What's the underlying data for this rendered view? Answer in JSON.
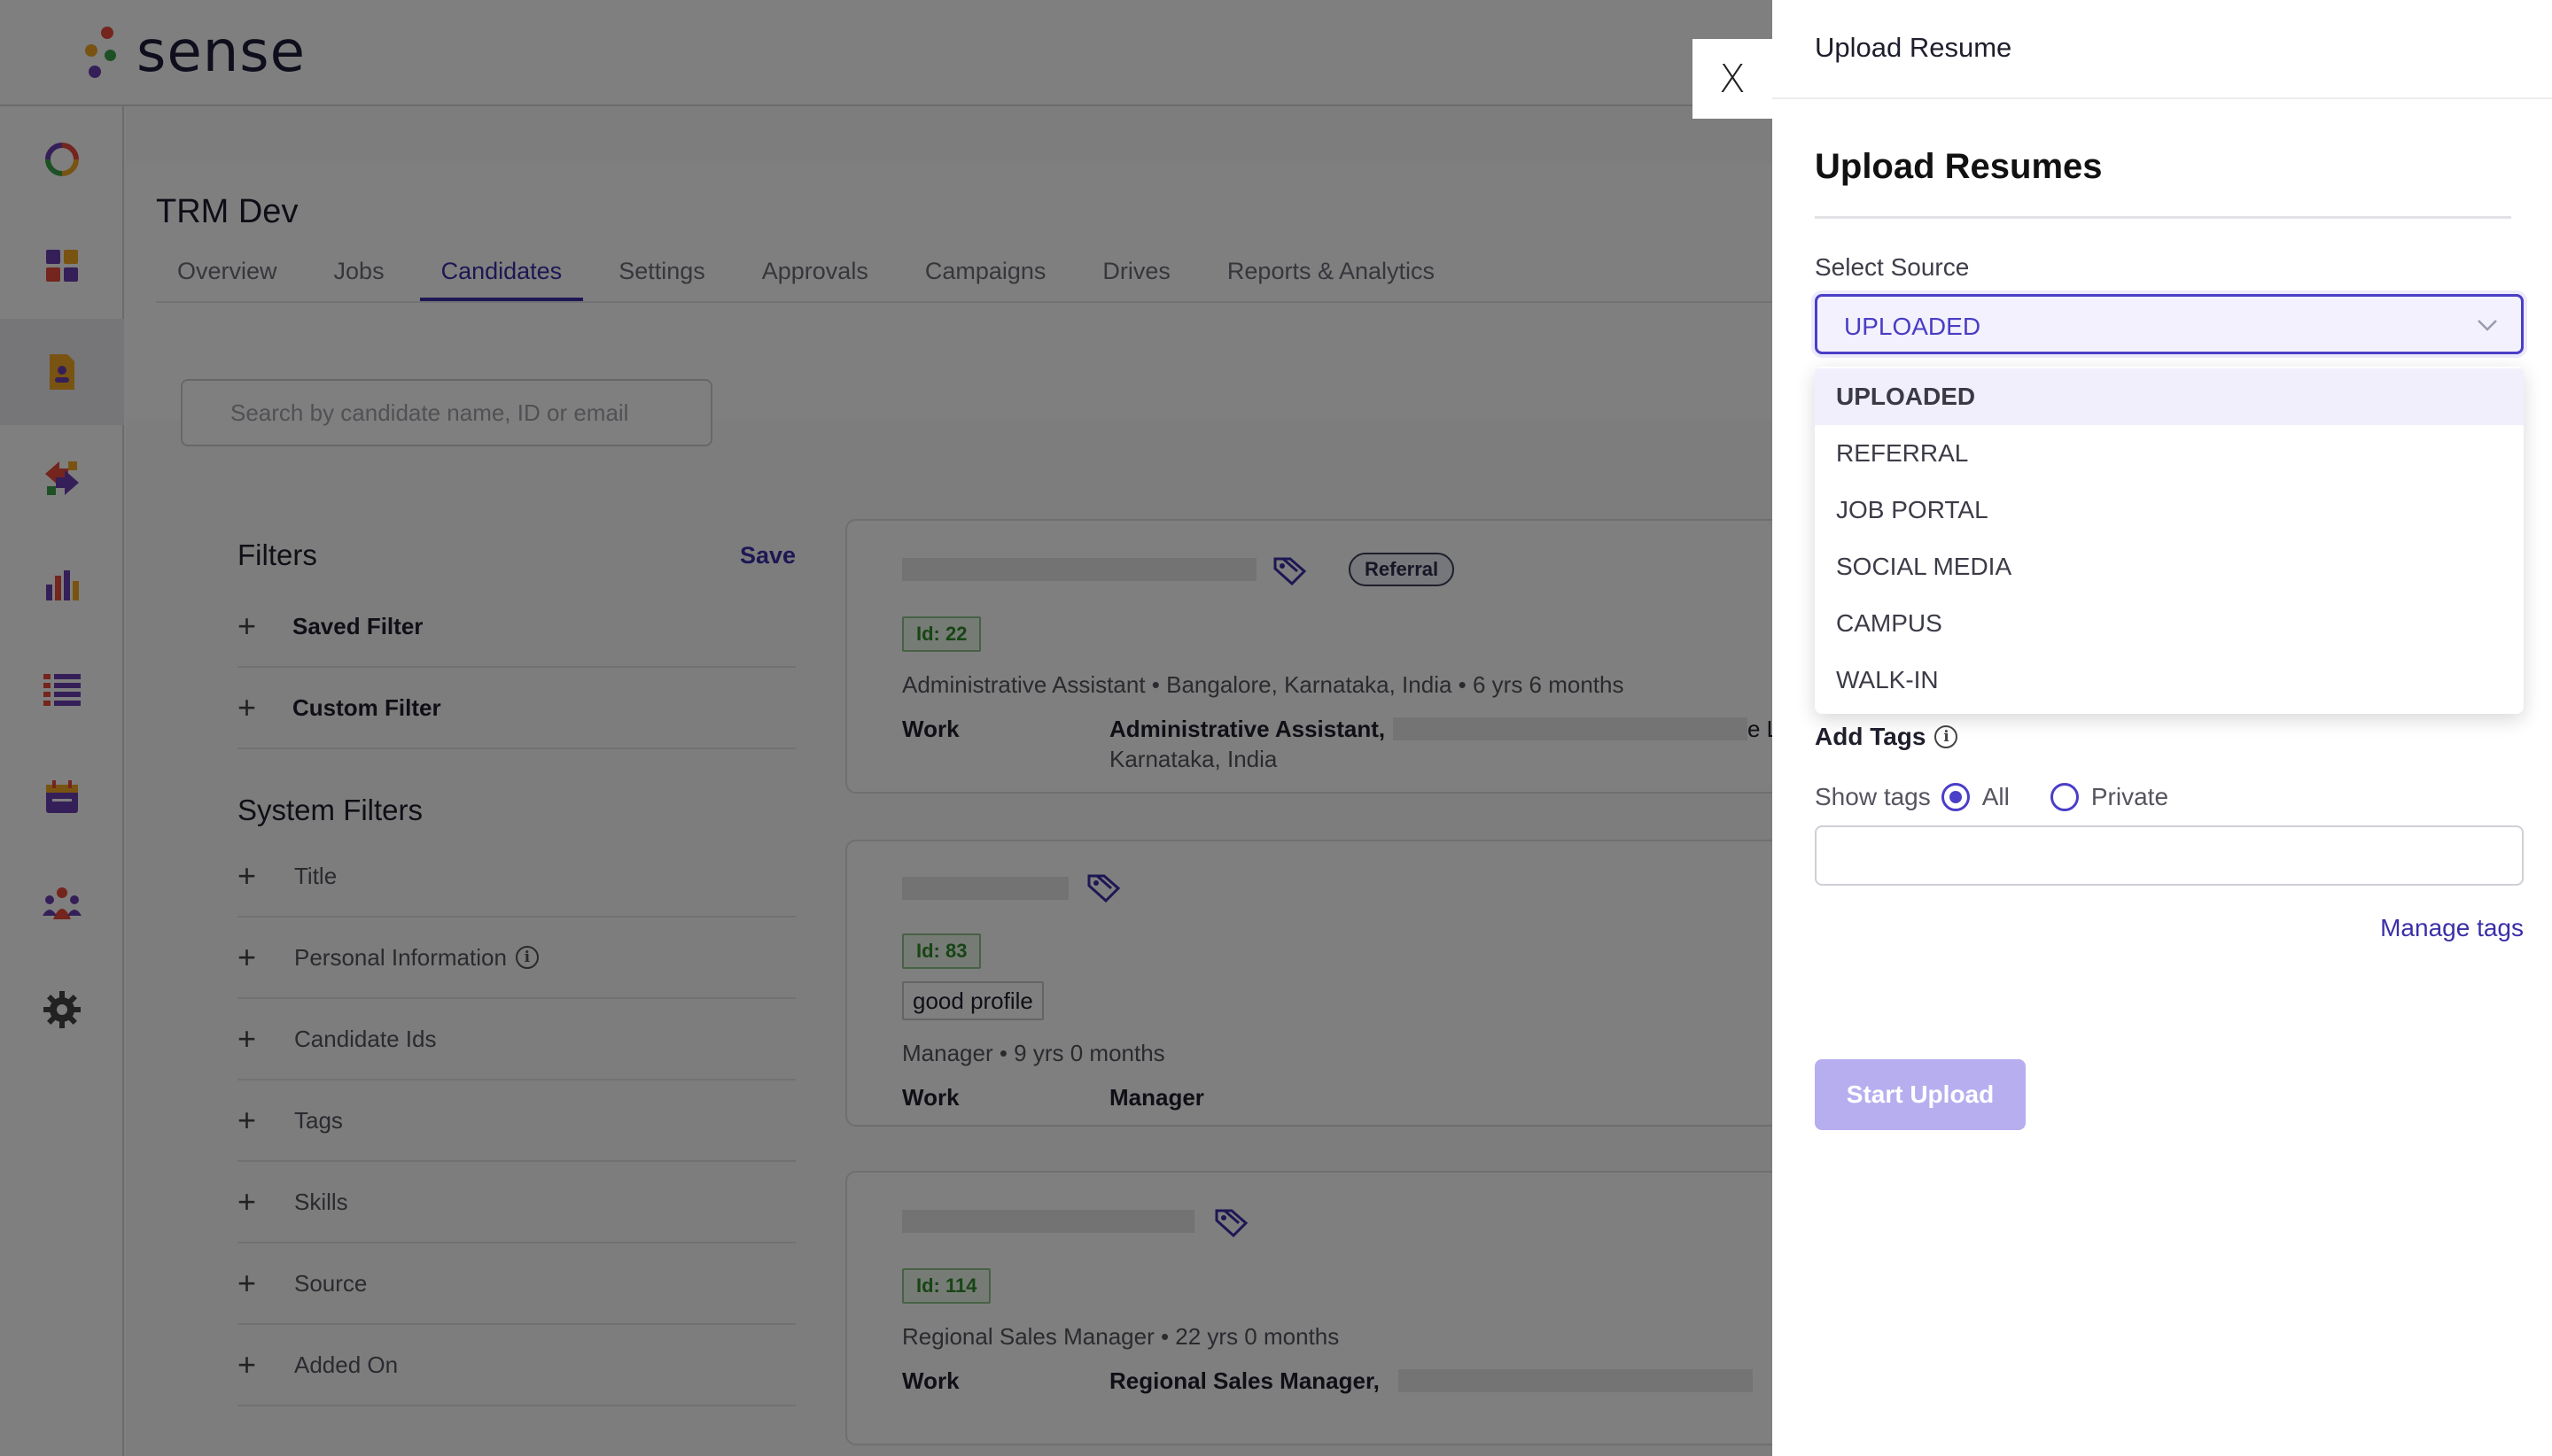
{
  "app": {
    "brand": "sense"
  },
  "header": {
    "org_title": "TRM Dev",
    "tabs": [
      {
        "label": "Overview"
      },
      {
        "label": "Jobs"
      },
      {
        "label": "Candidates",
        "active": true
      },
      {
        "label": "Settings"
      },
      {
        "label": "Approvals"
      },
      {
        "label": "Campaigns"
      },
      {
        "label": "Drives"
      },
      {
        "label": "Reports & Analytics"
      }
    ]
  },
  "sidebar": {
    "items": [
      {
        "icon": "dashboard-ring-icon"
      },
      {
        "icon": "apps-grid-icon"
      },
      {
        "icon": "candidates-doc-icon",
        "active": true
      },
      {
        "icon": "workflow-arrows-icon"
      },
      {
        "icon": "bar-chart-icon"
      },
      {
        "icon": "list-icon"
      },
      {
        "icon": "calendar-icon"
      },
      {
        "icon": "team-icon"
      },
      {
        "icon": "settings-gear-icon"
      }
    ]
  },
  "search": {
    "placeholder": "Search by candidate name, ID or email"
  },
  "filters": {
    "title": "Filters",
    "save_label": "Save",
    "rows": [
      {
        "label": "Saved Filter"
      },
      {
        "label": "Custom Filter"
      }
    ],
    "system_title": "System Filters",
    "system_rows": [
      {
        "label": "Title"
      },
      {
        "label": "Personal Information"
      },
      {
        "label": "Candidate Ids"
      },
      {
        "label": "Tags"
      },
      {
        "label": "Skills"
      },
      {
        "label": "Source"
      },
      {
        "label": "Added On"
      }
    ]
  },
  "candidates": [
    {
      "badge": "Referral",
      "id_label": "Id: 22",
      "meta": "Administrative Assistant • Bangalore, Karnataka, India • 6 yrs 6 months",
      "work_label": "Work",
      "work_title": "Administrative Assistant,",
      "work_location": "Karnataka, India",
      "work_cut": "e L"
    },
    {
      "id_label": "Id: 83",
      "note": "good profile",
      "meta": "Manager • 9 yrs 0 months",
      "work_label": "Work",
      "work_title": "Manager"
    },
    {
      "id_label": "Id: 114",
      "meta": "Regional Sales Manager • 22 yrs 0 months",
      "work_label": "Work",
      "work_title": "Regional Sales Manager,"
    }
  ],
  "drawer": {
    "header_title": "Upload Resume",
    "title": "Upload Resumes",
    "source_label": "Select Source",
    "selected_source": "UPLOADED",
    "source_options": [
      "UPLOADED",
      "REFERRAL",
      "JOB PORTAL",
      "SOCIAL MEDIA",
      "CAMPUS",
      "WALK-IN"
    ],
    "tags_title": "Add Tags",
    "show_tags_label": "Show tags",
    "radio_all": "All",
    "radio_private": "Private",
    "selected_visibility": "All",
    "manage_tags": "Manage tags",
    "start_upload": "Start Upload",
    "close_label": "X"
  },
  "colors": {
    "accent": "#4b3ec7",
    "tab_active": "#3a2fa8",
    "upload_disabled": "#b7aef0",
    "id_green": "#2f8a2a"
  }
}
